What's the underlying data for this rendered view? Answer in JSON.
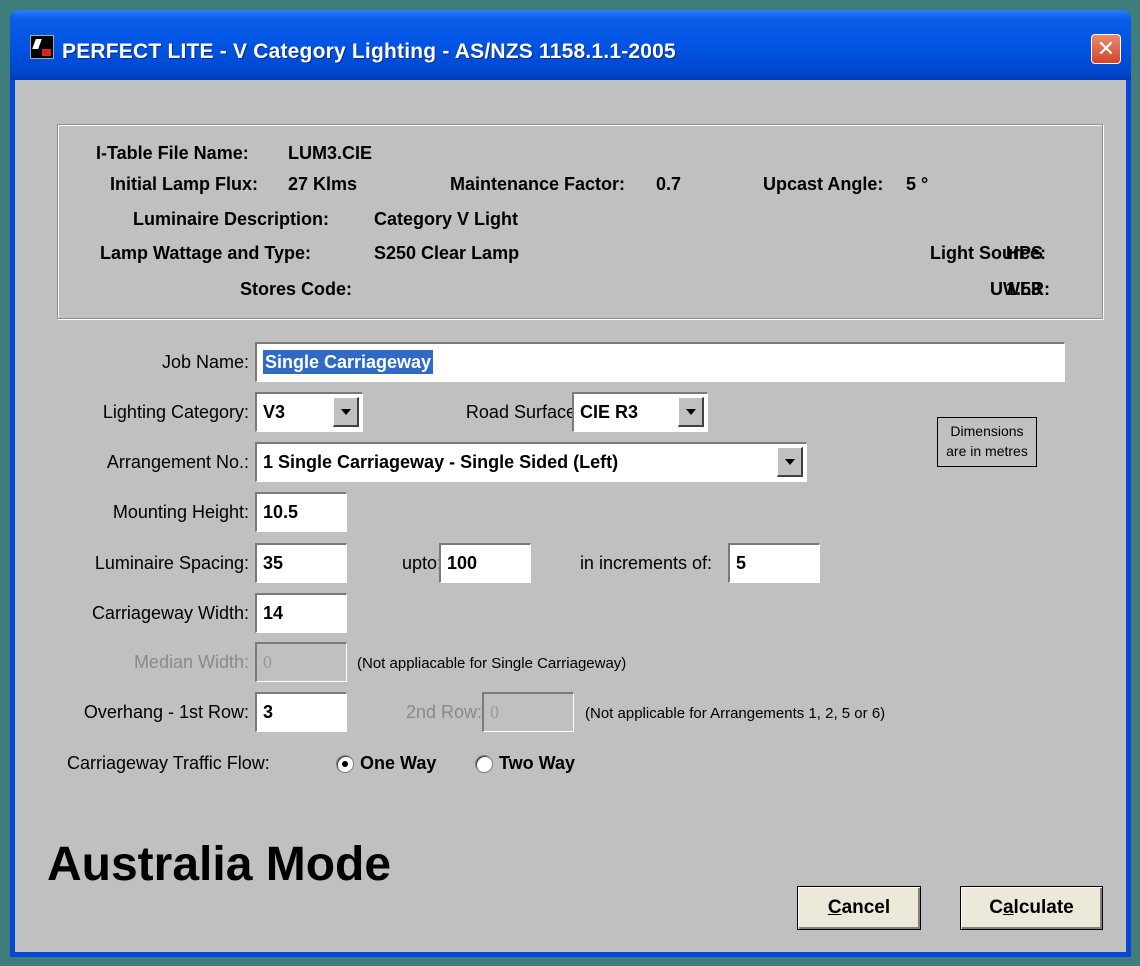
{
  "window": {
    "title": "PERFECT LITE - V Category Lighting - AS/NZS 1158.1.1-2005",
    "close_glyph": "✕"
  },
  "info": {
    "itable_label": "I-Table File Name:",
    "itable_value": "LUM3.CIE",
    "flux_label": "Initial Lamp Flux:",
    "flux_value": "27 Klms",
    "maint_label": "Maintenance Factor:",
    "maint_value": "0.7",
    "upcast_label": "Upcast Angle:",
    "upcast_value": "5 °",
    "desc_label": "Luminaire Description:",
    "desc_value": "Category V Light",
    "lamp_label": "Lamp Wattage and Type:",
    "lamp_value": "S250 Clear Lamp",
    "source_label": "Light Source:",
    "source_value": "HPS",
    "stores_label": "Stores Code:",
    "stores_value": "",
    "uwlr_label": "UWLR:",
    "uwlr_value": "1.53"
  },
  "form": {
    "job_name_label": "Job Name:",
    "job_name_value": "Single Carriageway",
    "category_label": "Lighting Category:",
    "category_value": "V3",
    "surface_label": "Road Surface:",
    "surface_value": "CIE R3",
    "dimensions_note_line1": "Dimensions",
    "dimensions_note_line2": "are in metres",
    "arrangement_label": "Arrangement No.:",
    "arrangement_value": "1  Single Carriageway - Single Sided (Left)",
    "mounting_label": "Mounting Height:",
    "mounting_value": "10.5",
    "spacing_label": "Luminaire Spacing:",
    "spacing_value": "35",
    "upto_label": "upto:",
    "upto_value": "100",
    "increments_label": "in increments of:",
    "increments_value": "5",
    "width_label": "Carriageway Width:",
    "width_value": "14",
    "median_label": "Median Width:",
    "median_value": "0",
    "median_note": "(Not appliacable for Single Carriageway)",
    "overhang_label": "Overhang - 1st Row:",
    "overhang_value": "3",
    "second_row_label": "2nd Row:",
    "second_row_value": "0",
    "second_row_note": "(Not applicable for Arrangements 1, 2, 5 or 6)",
    "traffic_label": "Carriageway Traffic Flow:",
    "one_way_label": "One Way",
    "two_way_label": "Two Way",
    "traffic_selected": "One Way"
  },
  "mode_text": "Australia Mode",
  "buttons": {
    "cancel_hotkey": "C",
    "cancel_rest": "ancel",
    "calculate_pre": "C",
    "calculate_hotkey": "a",
    "calculate_rest": "lculate"
  }
}
